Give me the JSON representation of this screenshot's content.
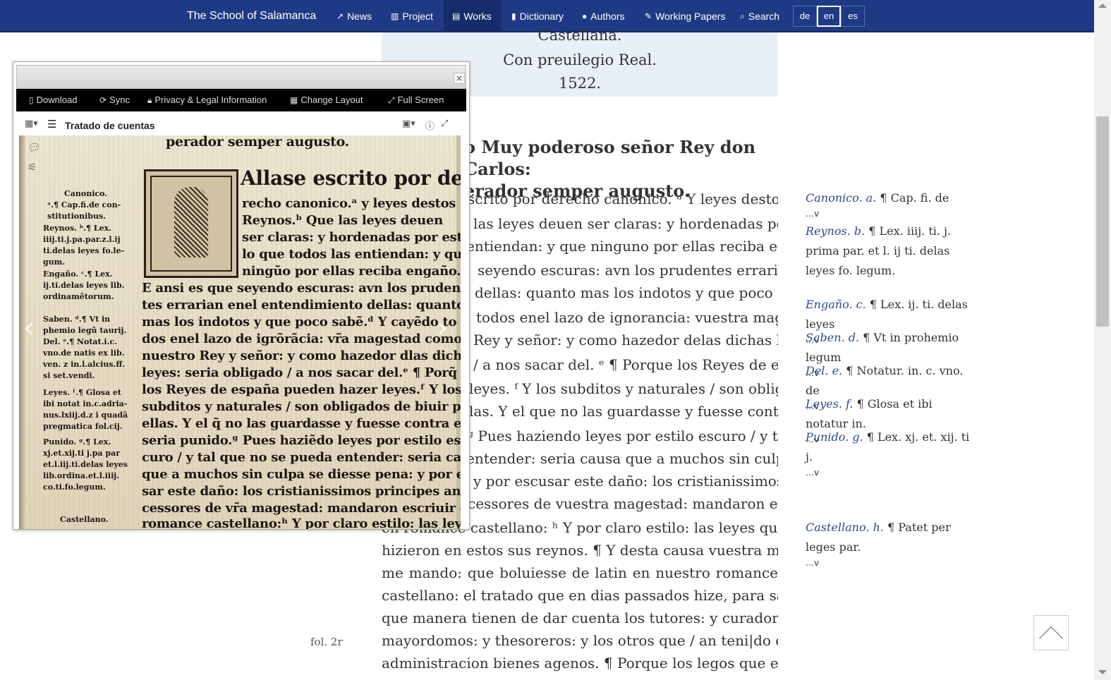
{
  "navbar": {
    "brand": "The School of Salamanca",
    "items": [
      {
        "label": "News",
        "icon": "share-icon"
      },
      {
        "label": "Project",
        "icon": "institution-icon"
      },
      {
        "label": "Works",
        "icon": "file-icon"
      },
      {
        "label": "Dictionary",
        "icon": "book-icon"
      },
      {
        "label": "Authors",
        "icon": "user-icon"
      },
      {
        "label": "Working Papers",
        "icon": "pencil-icon"
      },
      {
        "label": "Search",
        "icon": "search-icon"
      }
    ],
    "langs": [
      "de",
      "en",
      "es"
    ],
    "active_lang": "en",
    "active_item": "Works"
  },
  "title_block": {
    "line1": "Castellana.",
    "line2": "Con preuilegio Real.",
    "line3": "1522."
  },
  "heading": {
    "line1": "o Muy poderoso señor Rey don Carlos:",
    "line2": "erador semper augusto."
  },
  "text_lines": [
    "scrito por derecho canonico. ᵃ Y leyes destos",
    "las leyes deuen ser claras: y hordenadas por estilo",
    "entiendan: y que ninguno por ellas reciba engaño.",
    "seyendo escuras: avn los prudentes errarian en el",
    "dellas: quanto mas los indotos y que poco saben.",
    "todos enel lazo de ignorancia: vuestra magestad",
    "Rey y señor: y como hazedor delas dichas leyes:",
    "/ a nos sacar del. ᵉ ¶ Porque los Reyes de españa",
    "leyes. ᶠ Y los subditos y naturales / son obligados",
    "las. Y el que no las guardasse y fuesse contra ellas",
    "ᵍ Pues haziendo leyes por estilo escuro / y tal que",
    "entender: seria causa que a muchos sin culpa se",
    "y por escusar este daño: los cristianissimos",
    "cessores de vuestra magestad: mandaron escriuir",
    "en romance castellano: ʰ Y por claro estilo: las leyes que",
    "hizieron en estos sus reynos. ¶ Y desta causa vuestra magestad",
    "me mando: que boluiesse de latin en nuestro romance",
    "castellano: el tratado que en dias passados hize, para saber de",
    "que manera tienen de dar cuenta los tutores: y curadores:",
    "mayordomos: y thesoreros: y los otros que / an teni|do en",
    "administracion bienes agenos. ¶ Porque los legos que en"
  ],
  "notes": [
    {
      "label": "Canonico. a.",
      "text": " ¶ Cap. fi. de",
      "more": "…v"
    },
    {
      "label": "Reynos. b.",
      "text": " ¶ Lex. iiij. ti. j. prima par. et l. ij ti. delas leyes fo. legum.",
      "more": ""
    },
    {
      "label": "Engaño. c.",
      "text": " ¶ Lex. ij. ti. delas leyes",
      "more": "…v"
    },
    {
      "label": "Saben. d.",
      "text": " ¶ Vt in prohemio legum",
      "more": "…v"
    },
    {
      "label": "Del. e.",
      "text": " ¶ Notatur. in. c. vno. de",
      "more": "…v"
    },
    {
      "label": "Leyes. f.",
      "text": " ¶ Glosa et ibi notatur in.",
      "more": "…v"
    },
    {
      "label": "Punido. g.",
      "text": " ¶ Lex. xj. et. xij. ti j.",
      "more": "…v"
    },
    {
      "label": "Castellano. h.",
      "text": " ¶ Patet per leges par.",
      "more": "…v"
    }
  ],
  "folio": "fol. 2r",
  "viewer": {
    "close": "×",
    "toolbar": [
      {
        "label": "Download",
        "icon": "download-icon"
      },
      {
        "label": "Sync",
        "icon": "sync-icon"
      },
      {
        "label": "Privacy & Legal Information",
        "icon": "lock-icon"
      },
      {
        "label": "Change Layout",
        "icon": "layout-icon"
      },
      {
        "label": "Full Screen",
        "icon": "fullscreen-icon"
      }
    ],
    "title": "Tratado de cuentas",
    "scan": {
      "main_lines": [
        "perador semper augusto.",
        "Allase escrito por de",
        "recho canonico.ᵃ y leyes destos",
        "Reynos.ᵇ Que las leyes deuen",
        "ser claras: y hordenadas por esti",
        "lo que todos las entiendan: y que",
        "ningũo por ellas reciba engaño.ᶜ",
        "E ansi es que seyendo escuras: avn los pruden",
        "tes errarian enel entendimiento dellas: quanto",
        "mas los indotos y que poco sabẽ.ᵈ Y cayẽdo to",
        "dos enel lazo de igrõrãcia: vr̃a magestad como",
        "nuestro Rey y señor: y como hazedor dlas dichas",
        "leyes: seria obligado / a nos sacar del.ᵉ ¶ Porq̃",
        "los Reyes de españa pueden hazer leyes.ᶠ Y los",
        "subditos y naturales / son obligados de biuir por",
        "ellas. Y el q̃ no las guardasse y fuesse contra ellas",
        "seria punido.ᵍ Pues haziẽdo leyes por estilo es",
        "curo / y tal que no se pueda entender: seria causa",
        "que a muchos sin culpa se diesse pena: y por escu",
        "sar este daño: los cristianissimos principes ante",
        "cessores de vr̃a magestad: mandaron escriuir en",
        "romance castellano:ʰ Y por claro estilo: las leyes"
      ],
      "margin_lines": [
        "Canonico.",
        "ᵃ.¶ Cap.fi.de con-",
        "stitutionibus.",
        "Reynos. ᵇ.¶ Lex.",
        "iiij.ti.j.pa.par.z.l.ij",
        "ti.delas leyes fo.le-",
        "gum.",
        "Engaño. ᶜ.¶ Lex.",
        "ij.ti.delas leyes lib.",
        "ordinamẽtorum.",
        "Saben. ᵈ.¶ Vt in",
        "phemio legũ taurij.",
        "Del. ᵉ.¶ Notat.i.c.",
        "vno.de natis ex lib.",
        "ven. z in.l.alcius.ff.",
        "si set.vendi.",
        "Leyes. ᶠ.¶ Glosa et",
        "ibi notat in.c.adria-",
        "nus.lxiij.d.z i quadã",
        "pregmatica fol.cij.",
        "Punido. ᵍ.¶ Lex.",
        "xj.et.xij.ti j.pa par",
        "et.l.iij.ti.delas leyes",
        "lib.ordina.et.l.iiij.",
        "co.ti.fo.legum.",
        "Castellano."
      ]
    }
  },
  "colors": {
    "navbar": "#1f3a84",
    "title_block_bg": "#e8eff7",
    "note_label": "#2d4a8f",
    "viewer_toolbar": "#000000"
  }
}
